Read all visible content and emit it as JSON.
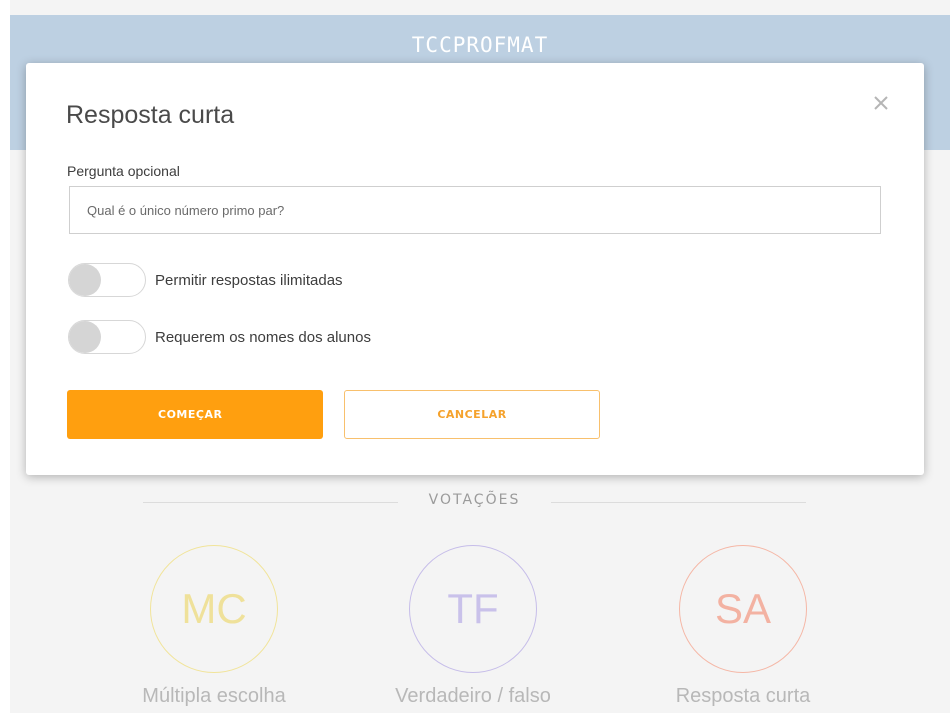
{
  "topbar": {
    "title": "TCCPROFMAT"
  },
  "section": {
    "label": "VOTAÇÕES"
  },
  "polls": [
    {
      "abbr": "MC",
      "label": "Múltipla escolha",
      "color": "#efe19a"
    },
    {
      "abbr": "TF",
      "label": "Verdadeiro / falso",
      "color": "#c9c1ea"
    },
    {
      "abbr": "SA",
      "label": "Resposta curta",
      "color": "#f3b2a2"
    }
  ],
  "modal": {
    "title": "Resposta curta",
    "close_icon": "close-icon",
    "question_label": "Pergunta opcional",
    "question_value": "",
    "question_placeholder": "Qual é o único número primo par?",
    "toggles": [
      {
        "label": "Permitir respostas ilimitadas",
        "on": false
      },
      {
        "label": "Requerem os nomes dos alunos",
        "on": false
      }
    ],
    "start_label": "COMEÇAR",
    "cancel_label": "CANCELAR"
  },
  "colors": {
    "accent": "#ff9f0f",
    "topbar": "#bdd0e2"
  }
}
